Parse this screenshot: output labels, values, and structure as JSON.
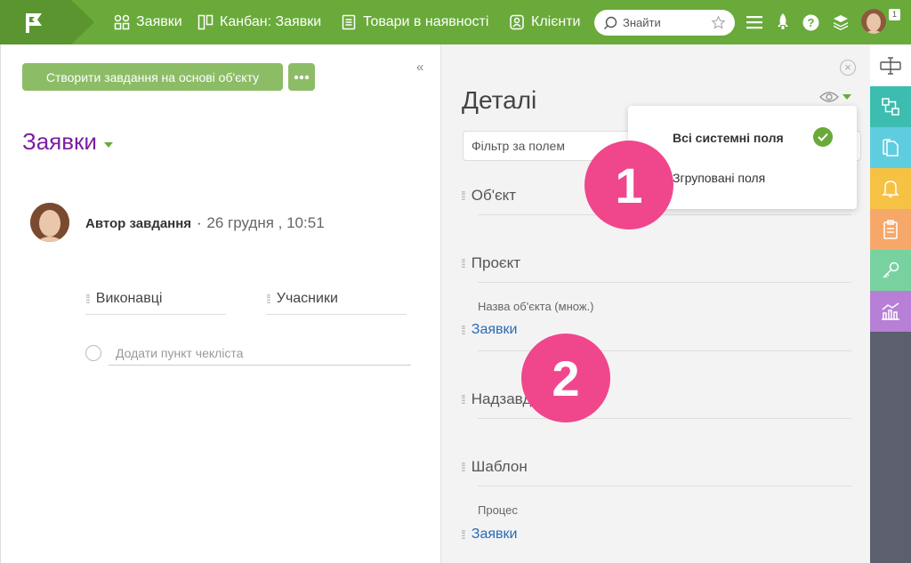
{
  "topbar": {
    "nav": [
      {
        "label": "Заявки",
        "icon": "grid-icon"
      },
      {
        "label": "Канбан: Заявки",
        "icon": "kanban-icon"
      },
      {
        "label": "Товари в наявності",
        "icon": "document-icon"
      },
      {
        "label": "Клієнти",
        "icon": "contacts-icon"
      }
    ],
    "search_placeholder": "Знайти",
    "notification_count": "1",
    "colors": {
      "bar": "#69aa3a",
      "logo": "#5a9530"
    }
  },
  "left": {
    "create_button": "Створити завдання на основі об'єкту",
    "more_button": "•••",
    "collapse": "«",
    "object_title": "Заявки",
    "author": {
      "name": "Автор завдання",
      "date": "26 грудня , 10:51"
    },
    "fields": [
      "Виконавці",
      "Учасники"
    ],
    "checklist_placeholder": "Додати пункт чекліста"
  },
  "details": {
    "title": "Деталі",
    "filter_placeholder": "Фільтр за полем",
    "sections": {
      "object": "Об'єкт",
      "project": "Проєкт",
      "object_name_label": "Назва об'єкта (множ.)",
      "object_name_value": "Заявки",
      "parent": "Надзавдання",
      "template": "Шаблон",
      "process_label": "Процес",
      "process_value": "Заявки"
    },
    "dropdown": {
      "items": [
        "Всі системні поля",
        "Згруповані поля"
      ],
      "selected": "Всі системні поля"
    }
  },
  "strip": {
    "buttons": [
      {
        "icon": "structure-icon",
        "color": "#3dbcb0"
      },
      {
        "icon": "files-icon",
        "color": "#5fcde0"
      },
      {
        "icon": "bell-icon",
        "color": "#f6c244"
      },
      {
        "icon": "clipboard-icon",
        "color": "#f5a86a"
      },
      {
        "icon": "key-icon",
        "color": "#78d2a0"
      },
      {
        "icon": "chart-icon",
        "color": "#b77fd6"
      }
    ]
  },
  "callouts": [
    "1",
    "2"
  ]
}
